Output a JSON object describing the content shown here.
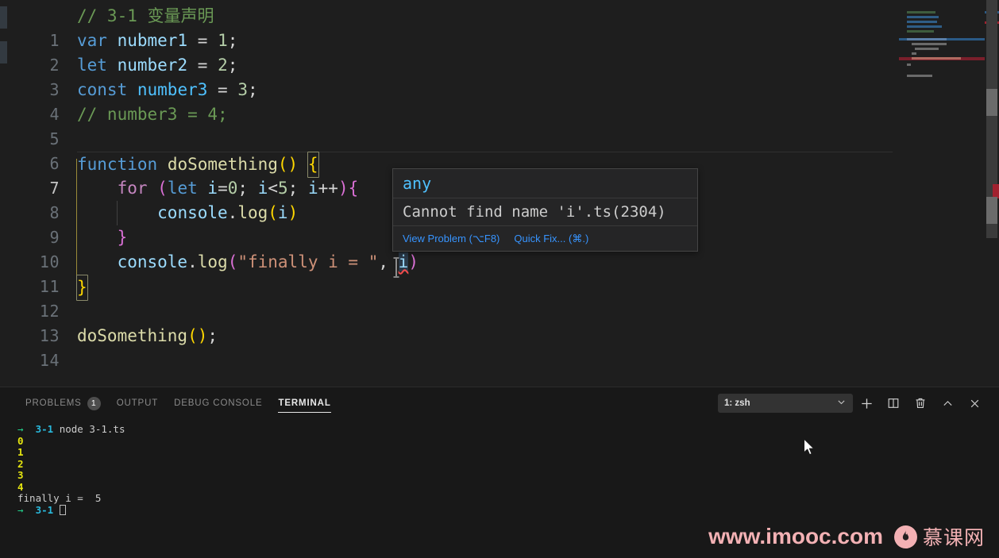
{
  "editor": {
    "language": "typescript",
    "lines": [
      {
        "num": "1",
        "text": "// 3-1 变量声明"
      },
      {
        "num": "2",
        "text": "var nubmer1 = 1;"
      },
      {
        "num": "3",
        "text": "let number2 = 2;"
      },
      {
        "num": "4",
        "text": "const number3 = 3;"
      },
      {
        "num": "5",
        "text": "// number3 = 4;"
      },
      {
        "num": "6",
        "text": ""
      },
      {
        "num": "7",
        "text": "function doSomething() {"
      },
      {
        "num": "8",
        "text": "    for (let i=0; i<5; i++){"
      },
      {
        "num": "9",
        "text": "        console.log(i)"
      },
      {
        "num": "10",
        "text": "    }"
      },
      {
        "num": "11",
        "text": "    console.log(\"finally i = \", i)"
      },
      {
        "num": "12",
        "text": "}"
      },
      {
        "num": "13",
        "text": ""
      },
      {
        "num": "14",
        "text": "doSomething();"
      }
    ],
    "active_line": "7",
    "error_token": "i"
  },
  "hover": {
    "signature": "any",
    "message": "Cannot find name 'i'.",
    "code_ref": "ts(2304)",
    "actions": [
      {
        "label": "View Problem (⌥F8)"
      },
      {
        "label": "Quick Fix... (⌘.)"
      }
    ]
  },
  "panel": {
    "tabs": [
      {
        "label": "PROBLEMS",
        "badge": "1",
        "active": false
      },
      {
        "label": "OUTPUT",
        "badge": "",
        "active": false
      },
      {
        "label": "DEBUG CONSOLE",
        "badge": "",
        "active": false
      },
      {
        "label": "TERMINAL",
        "badge": "",
        "active": true
      }
    ],
    "terminal_select": "1: zsh",
    "tools": [
      {
        "name": "new-terminal",
        "icon": "plus",
        "title": "New Terminal"
      },
      {
        "name": "split-terminal",
        "icon": "split",
        "title": "Split Terminal"
      },
      {
        "name": "kill-terminal",
        "icon": "trash",
        "title": "Kill Terminal"
      },
      {
        "name": "maximize-panel",
        "icon": "chevron-up",
        "title": "Maximize Panel Size"
      },
      {
        "name": "close-panel",
        "icon": "close",
        "title": "Close Panel"
      }
    ]
  },
  "terminal": {
    "prompt_arrow": "→",
    "prompt_dir": "3-1",
    "command": "node 3-1.ts",
    "output": [
      "0",
      "1",
      "2",
      "3",
      "4"
    ],
    "final_line": "finally i =  5"
  },
  "watermark": {
    "url": "www.imooc.com",
    "brand_cn": "慕课网",
    "logo_glyph": "●",
    "color": "#f3b1b4"
  },
  "colors": {
    "editor_bg": "#1e1e1e",
    "panel_bg": "#181818",
    "comment": "#6A9955",
    "keyword": "#569CD6",
    "control_keyword": "#C586C0",
    "variable": "#9CDCFE",
    "function": "#DCDCAA",
    "number": "#B5CEA8",
    "string": "#CE9178",
    "error_squiggle": "#f14c4c",
    "link": "#3794ff",
    "terminal_dir": "#29b8db",
    "terminal_number": "#e5e510",
    "terminal_arrow": "#23d18b"
  }
}
